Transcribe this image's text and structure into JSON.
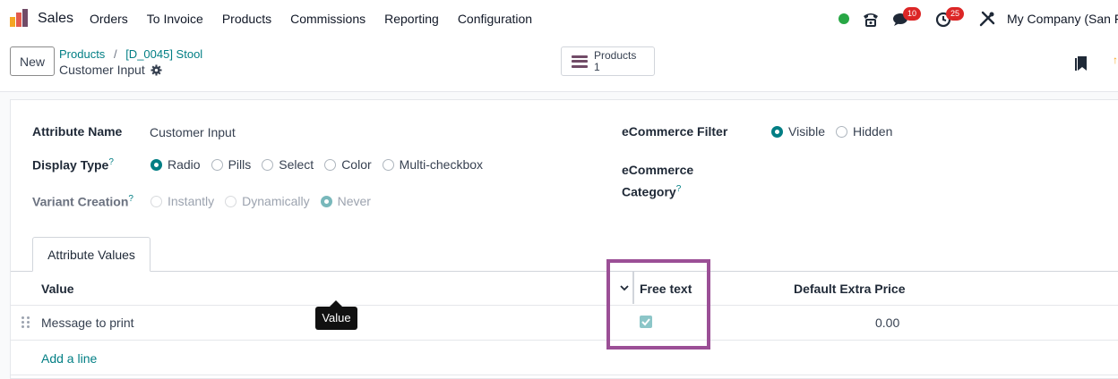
{
  "app": {
    "name": "Sales",
    "logo_colors": [
      "#f5a623",
      "#e25a4e",
      "#714b67"
    ]
  },
  "nav": {
    "items": [
      "Orders",
      "To Invoice",
      "Products",
      "Commissions",
      "Reporting",
      "Configuration"
    ]
  },
  "systray": {
    "status_color": "#28a745",
    "phone_icon": "phone-icon",
    "messages_icon": "chat-icon",
    "messages_count": "10",
    "activities_icon": "clock-icon",
    "activities_count": "25",
    "tools_icon": "tools-icon",
    "company": "My Company (San Fr"
  },
  "control_panel": {
    "new_label": "New",
    "breadcrumb": {
      "parent": "Products",
      "separator": "/",
      "current": "[D_0045] Stool"
    },
    "record_name": "Customer Input",
    "smart_button": {
      "label": "Products",
      "count": "1"
    }
  },
  "form": {
    "attribute_name_label": "Attribute Name",
    "attribute_name_value": "Customer Input",
    "display_type_label": "Display Type",
    "display_type_help": "?",
    "display_type_options": [
      {
        "label": "Radio",
        "selected": true
      },
      {
        "label": "Pills",
        "selected": false
      },
      {
        "label": "Select",
        "selected": false
      },
      {
        "label": "Color",
        "selected": false
      },
      {
        "label": "Multi-checkbox",
        "selected": false
      }
    ],
    "variant_creation_label": "Variant Creation",
    "variant_creation_help": "?",
    "variant_creation_options": [
      {
        "label": "Instantly",
        "selected": false
      },
      {
        "label": "Dynamically",
        "selected": false
      },
      {
        "label": "Never",
        "selected": true
      }
    ],
    "ecommerce_filter_label": "eCommerce Filter",
    "ecommerce_filter_options": [
      {
        "label": "Visible",
        "selected": true
      },
      {
        "label": "Hidden",
        "selected": false
      }
    ],
    "ecommerce_category_label_1": "eCommerce",
    "ecommerce_category_label_2": "Category",
    "ecommerce_category_help": "?"
  },
  "tabs": {
    "attribute_values": "Attribute Values"
  },
  "table": {
    "columns": {
      "value": "Value",
      "free_text": "Free text",
      "default_extra_price": "Default Extra Price"
    },
    "rows": [
      {
        "value": "Message to print",
        "free_text": true,
        "default_extra_price": "0.00"
      }
    ],
    "add_line": "Add a line"
  },
  "tooltip": {
    "text": "Value"
  },
  "colors": {
    "accent": "#017e84",
    "brand": "#714b67",
    "highlight": "#9b4f96",
    "badge": "#dc2626"
  }
}
